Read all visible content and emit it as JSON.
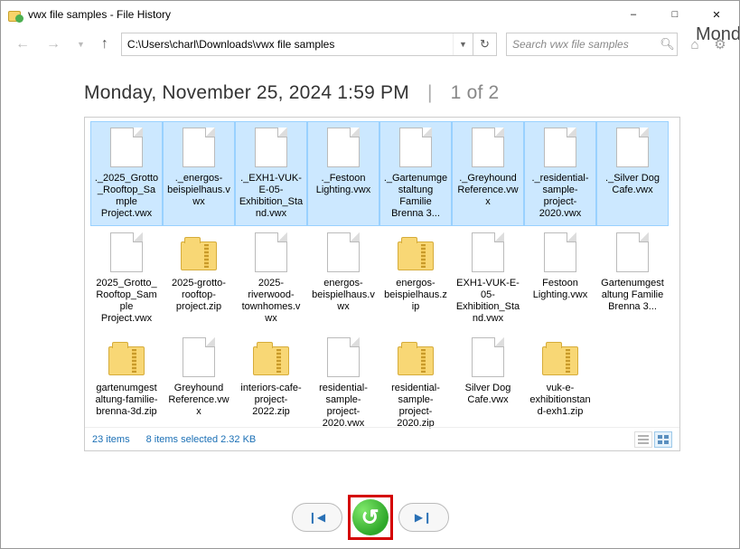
{
  "window": {
    "title": "vwx file samples - File History"
  },
  "nav": {
    "path": "C:\\Users\\charl\\Downloads\\vwx file samples",
    "search_placeholder": "Search vwx file samples"
  },
  "header": {
    "date": "Monday, November 25, 2024 1:59 PM",
    "separator": "|",
    "page": "1 of 2",
    "next_peek": "Monda"
  },
  "files": [
    {
      "name": "._2025_Grotto_Rooftop_Sample Project.vwx",
      "kind": "file",
      "selected": true
    },
    {
      "name": "._energos-beispielhaus.vwx",
      "kind": "file",
      "selected": true
    },
    {
      "name": "._EXH1-VUK-E-05-Exhibition_Stand.vwx",
      "kind": "file",
      "selected": true
    },
    {
      "name": "._Festoon Lighting.vwx",
      "kind": "file",
      "selected": true
    },
    {
      "name": "._Gartenumgestaltung Familie Brenna 3...",
      "kind": "file",
      "selected": true
    },
    {
      "name": "._Greyhound Reference.vwx",
      "kind": "file",
      "selected": true
    },
    {
      "name": "._residential-sample-project-2020.vwx",
      "kind": "file",
      "selected": true
    },
    {
      "name": "._Silver Dog Cafe.vwx",
      "kind": "file",
      "selected": true
    },
    {
      "name": "2025_Grotto_Rooftop_Sample Project.vwx",
      "kind": "file",
      "selected": false
    },
    {
      "name": "2025-grotto-rooftop-project.zip",
      "kind": "zip",
      "selected": false
    },
    {
      "name": "2025-riverwood-townhomes.vwx",
      "kind": "file",
      "selected": false
    },
    {
      "name": "energos-beispielhaus.vwx",
      "kind": "file",
      "selected": false
    },
    {
      "name": "energos-beispielhaus.zip",
      "kind": "zip",
      "selected": false
    },
    {
      "name": "EXH1-VUK-E-05-Exhibition_Stand.vwx",
      "kind": "file",
      "selected": false
    },
    {
      "name": "Festoon Lighting.vwx",
      "kind": "file",
      "selected": false
    },
    {
      "name": "Gartenumgestaltung Familie Brenna 3...",
      "kind": "file",
      "selected": false
    },
    {
      "name": "gartenumgestaltung-familie-brenna-3d.zip",
      "kind": "zip",
      "selected": false
    },
    {
      "name": "Greyhound Reference.vwx",
      "kind": "file",
      "selected": false
    },
    {
      "name": "interiors-cafe-project-2022.zip",
      "kind": "zip",
      "selected": false
    },
    {
      "name": "residential-sample-project-2020.vwx",
      "kind": "file",
      "selected": false
    },
    {
      "name": "residential-sample-project-2020.zip",
      "kind": "zip",
      "selected": false
    },
    {
      "name": "Silver Dog Cafe.vwx",
      "kind": "file",
      "selected": false
    },
    {
      "name": "vuk-e-exhibitionstand-exh1.zip",
      "kind": "zip",
      "selected": false
    }
  ],
  "status": {
    "count": "23 items",
    "selection": "8 items selected  2.32 KB"
  }
}
